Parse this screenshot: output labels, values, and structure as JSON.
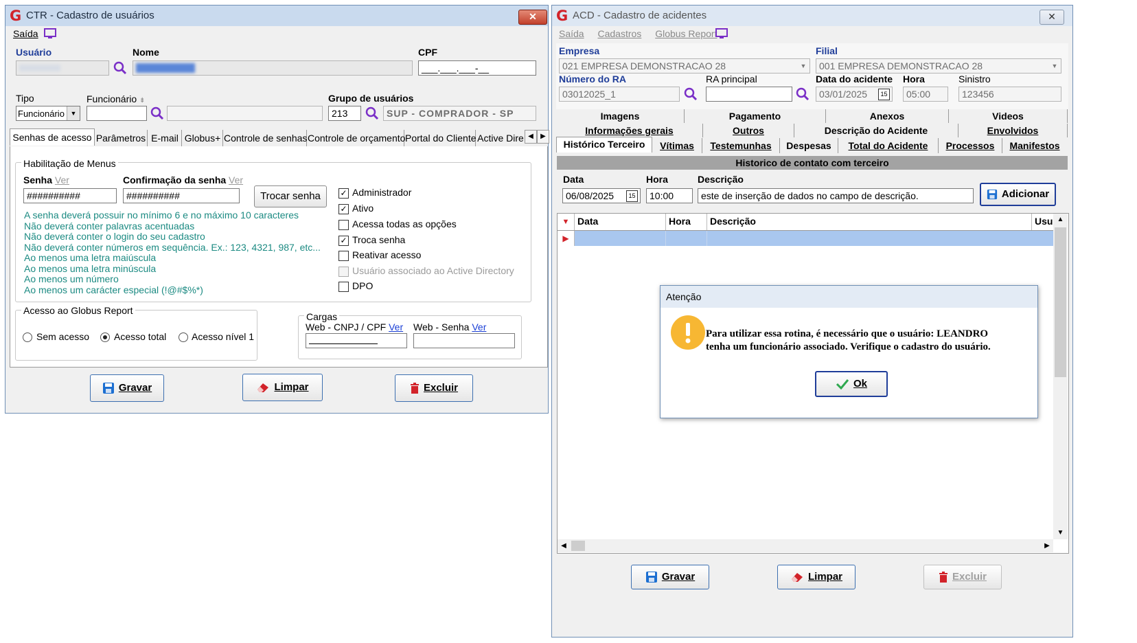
{
  "colors": {
    "accent": "#1f3d99",
    "rules_text": "#1b8a82",
    "danger": "#d2232a",
    "selected_row": "#a9c7ef"
  },
  "ctr": {
    "title": "CTR - Cadastro de usuários",
    "close_glyph": "✕",
    "menu": {
      "exit": "Saída"
    },
    "fields": {
      "usuario_label": "Usuário",
      "nome_label": "Nome",
      "cpf_label": "CPF",
      "cpf_mask": "___.___.___-__",
      "tipo_label": "Tipo",
      "tipo_value": "Funcionário",
      "funcionario_label": "Funcionário",
      "grupo_label": "Grupo de usuários",
      "grupo_code": "213",
      "grupo_name": "SUP - COMPRADOR - SP"
    },
    "tabs": [
      "Senhas de acesso",
      "Parâmetros",
      "E-mail",
      "Globus+",
      "Controle de senhas",
      "Controle de orçamento",
      "Portal do Cliente",
      "Active Dire"
    ],
    "menus_group": {
      "legend": "Habilitação de Menus",
      "senha_label": "Senha",
      "ver": "Ver",
      "senha_value": "##########",
      "confirmacao_label": "Confirmação da senha",
      "confirmacao_value": "##########",
      "trocar_button": "Trocar senha",
      "rules": [
        "A senha deverá possuir no mínimo 6 e no máximo 10 caracteres",
        "Não deverá conter palavras acentuadas",
        "Não deverá conter o login do seu cadastro",
        "Não deverá conter números em sequência. Ex.: 123, 4321, 987, etc...",
        "Ao menos uma letra maiúscula",
        "Ao menos uma letra minúscula",
        "Ao menos um número",
        "Ao menos um carácter especial (!@#$%*)"
      ],
      "checks": [
        {
          "label": "Administrador",
          "checked": true
        },
        {
          "label": "Ativo",
          "checked": true
        },
        {
          "label": "Acessa todas as opções",
          "checked": false
        },
        {
          "label": "Troca senha",
          "checked": true
        },
        {
          "label": "Reativar acesso",
          "checked": false
        },
        {
          "label": "Usuário associado ao Active Directory",
          "checked": false,
          "disabled": true
        },
        {
          "label": "DPO",
          "checked": false
        }
      ]
    },
    "report_group": {
      "legend": "Acesso ao Globus Report",
      "options": [
        "Sem acesso",
        "Acesso total",
        "Acesso nível 1"
      ],
      "selected": "Acesso total"
    },
    "cargas_group": {
      "legend": "Cargas",
      "cnpj_label": "Web - CNPJ / CPF",
      "senha_label": "Web - Senha",
      "ver": "Ver"
    },
    "buttons": {
      "save": "Gravar",
      "clear": "Limpar",
      "delete": "Excluir"
    }
  },
  "acd": {
    "title": "ACD - Cadastro de acidentes",
    "close_glyph": "✕",
    "menu": [
      "Saída",
      "Cadastros",
      "Globus Report"
    ],
    "fields": {
      "empresa_label": "Empresa",
      "empresa_value": "021 EMPRESA DEMONSTRACAO 28",
      "filial_label": "Filial",
      "filial_value": "001 EMPRESA DEMONSTRACAO 28",
      "numero_ra_label": "Número do RA",
      "numero_ra_value": "03012025_1",
      "ra_principal_label": "RA principal",
      "data_acidente_label": "Data do acidente",
      "data_acidente_value": "03/01/2025",
      "hora_label": "Hora",
      "hora_value": "05:00",
      "sinistro_label": "Sinistro",
      "sinistro_value": "123456"
    },
    "tabs_row1": [
      "Imagens",
      "Pagamento",
      "Anexos",
      "Videos"
    ],
    "tabs_row2": [
      "Informações gerais",
      "Outros",
      "Descrição do Acidente",
      "Envolvidos"
    ],
    "tabs_row3": [
      "Histórico Terceiro",
      "Vítimas",
      "Testemunhas",
      "Despesas",
      "Total do Acidente",
      "Processos",
      "Manifestos"
    ],
    "section_title": "Historico de contato com terceiro",
    "entry": {
      "data_label": "Data",
      "data_value": "06/08/2025",
      "hora_label": "Hora",
      "hora_value": "10:00",
      "descricao_label": "Descrição",
      "descricao_value": "este de inserção de dados no campo de descrição.",
      "add_button": "Adicionar"
    },
    "calendar_icon_text": "15",
    "grid": {
      "columns": [
        "Data",
        "Hora",
        "Descrição",
        "Usu"
      ]
    },
    "buttons": {
      "save": "Gravar",
      "clear": "Limpar",
      "delete": "Excluir"
    }
  },
  "dialog": {
    "title": "Atenção",
    "message_line1": "Para utilizar essa rotina, é necessário que o usuário: LEANDRO",
    "message_line2": "tenha um funcionário associado. Verifique o cadastro do usuário.",
    "ok_button": "Ok"
  }
}
